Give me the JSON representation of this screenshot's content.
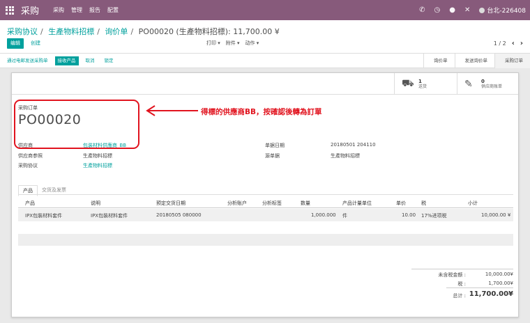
{
  "topbar": {
    "app_title": "采购",
    "menu": [
      "采购",
      "管理",
      "报告",
      "配置"
    ],
    "company": "台北-226408"
  },
  "breadcrumb": {
    "items": [
      "采购协议",
      "生產物料招標",
      "询价单"
    ],
    "current": "PO00020 (生產物料招標): 11,700.00 ¥"
  },
  "control": {
    "edit_label": "编辑",
    "create_label": "创建",
    "print_label": "打印 ▾",
    "attach_label": "附件 ▾",
    "action_label": "动作 ▾",
    "pager": "1 / 2"
  },
  "status": {
    "buttons": [
      "通过电邮发送采购单",
      "接收产品",
      "取消",
      "锁定"
    ],
    "stages": [
      "询价单",
      "发送询价单",
      "采购订单"
    ]
  },
  "smart": {
    "shipment_count": "1",
    "shipment_label": "送货",
    "bill_count": "0",
    "bill_label": "供应商账单"
  },
  "doc": {
    "label": "采购订单",
    "name": "PO00020"
  },
  "fields": {
    "vendor_label": "供应商",
    "vendor_value": "包装材料供應商_BB",
    "vendor_ref_label": "供应商参照",
    "vendor_ref_value": "生產物料招標",
    "agreement_label": "采购协议",
    "agreement_value": "生產物料招標",
    "order_date_label": "单据日期",
    "order_date_value": "20180501 204110",
    "source_label": "源单据",
    "source_value": "生產物料招標"
  },
  "annotation": {
    "text": "得標的供應商BB，按確認後轉為訂單"
  },
  "tabs": [
    "产品",
    "交货及发票"
  ],
  "table": {
    "headers": [
      "产品",
      "说明",
      "预定交货日期",
      "分析账户",
      "分析标签",
      "数量",
      "产品计量单位",
      "单价",
      "税",
      "小计"
    ],
    "rows": [
      [
        "IPX包裝材料套件",
        "IPX包裝材料套件",
        "20180505 080000",
        "",
        "",
        "1,000.000",
        "件",
        "10.00",
        "17%进项税",
        "10,000.00 ¥"
      ]
    ]
  },
  "totals": {
    "untaxed_label": "未含税金额 :",
    "untaxed_value": "10,000.00¥",
    "tax_label": "税 :",
    "tax_value": "1,700.00¥",
    "total_label": "总计 :",
    "total_value": "11,700.00¥"
  },
  "colors": {
    "brand": "#875a7b",
    "accent": "#00a09d",
    "annotation": "#e1131e"
  }
}
